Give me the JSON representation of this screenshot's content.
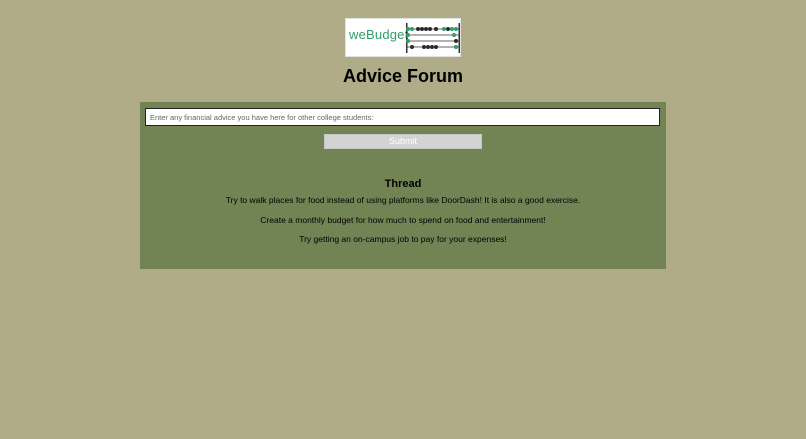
{
  "logo": {
    "text": "weBudget",
    "icon": "abacus-icon",
    "brand_color": "#2e9e6b"
  },
  "header": {
    "title": "Advice Forum"
  },
  "form": {
    "placeholder": "Enter any financial advice you have here for other college students:",
    "value": "",
    "submit_label": "Submit"
  },
  "thread": {
    "heading": "Thread",
    "posts": [
      "Try to walk places for food instead of using platforms like DoorDash! It is also a good exercise.",
      "Create a monthly budget for how much to spend on food and entertainment!",
      "Try getting an on-campus job to pay for your expenses!"
    ]
  },
  "colors": {
    "page_background": "#b1ac88",
    "panel_background": "#738454",
    "button_background": "#d3d3d3"
  }
}
